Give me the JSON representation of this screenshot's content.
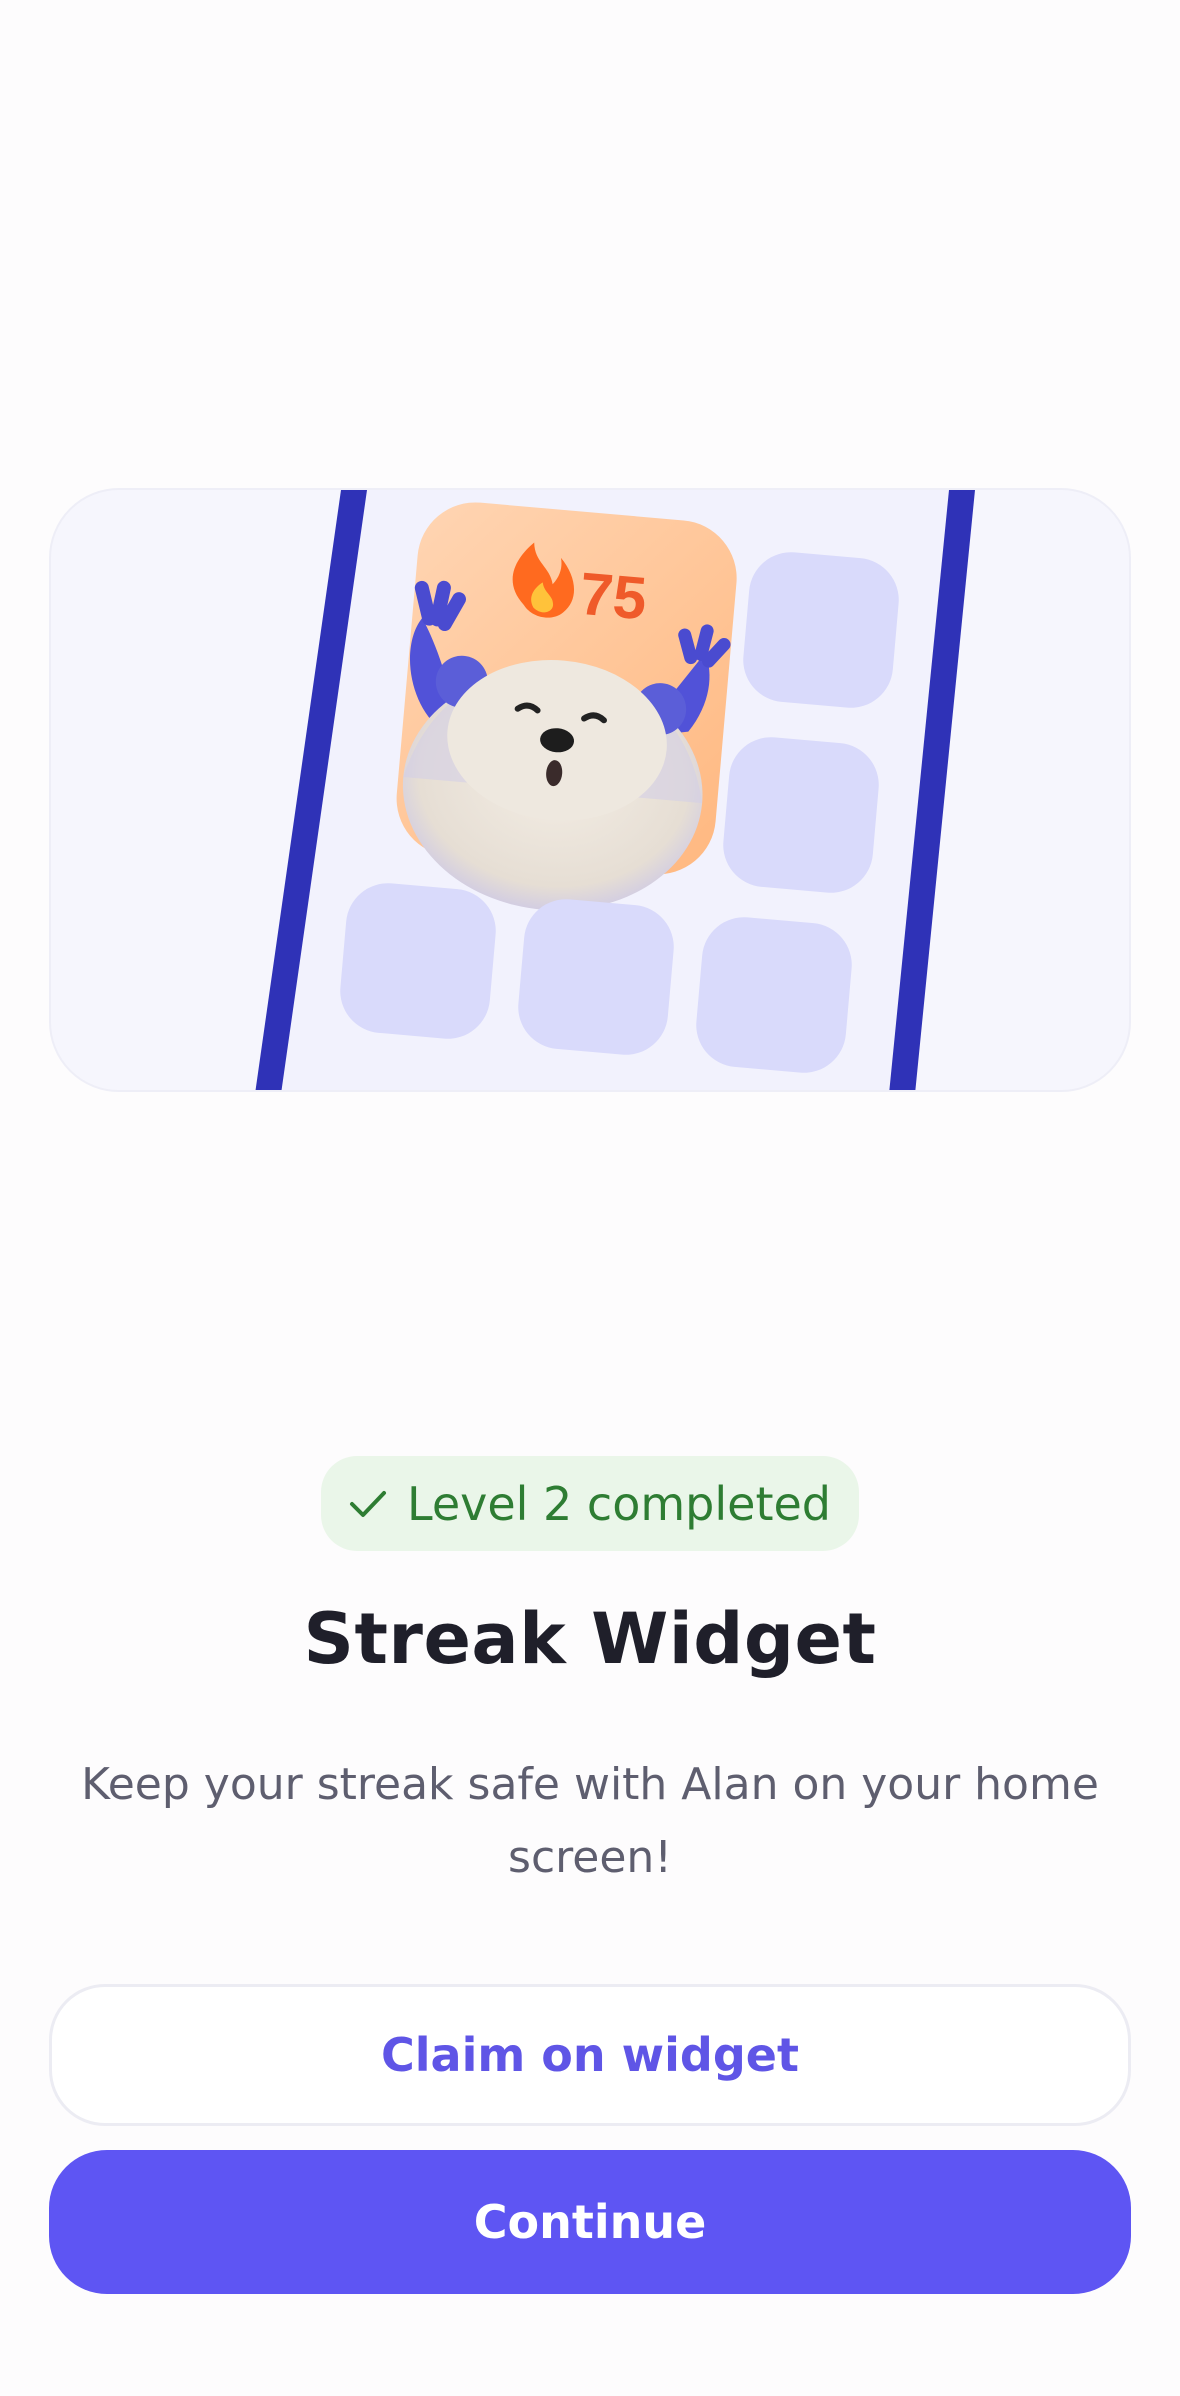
{
  "hero": {
    "streak_count": "75",
    "flame_icon": "flame-icon",
    "mascot": "bear-mascot"
  },
  "status_badge": {
    "icon": "check-icon",
    "label": "Level 2 completed",
    "color": "#2e7d33",
    "background": "#eaf6e9"
  },
  "title": "Streak Widget",
  "subtitle": "Keep your streak safe with Alan on your home screen!",
  "actions": {
    "claim_label": "Claim on widget",
    "continue_label": "Continue"
  },
  "colors": {
    "accent": "#5e55f3",
    "phone_frame": "#2f32b7",
    "widget_tile": "#d9dafb"
  }
}
